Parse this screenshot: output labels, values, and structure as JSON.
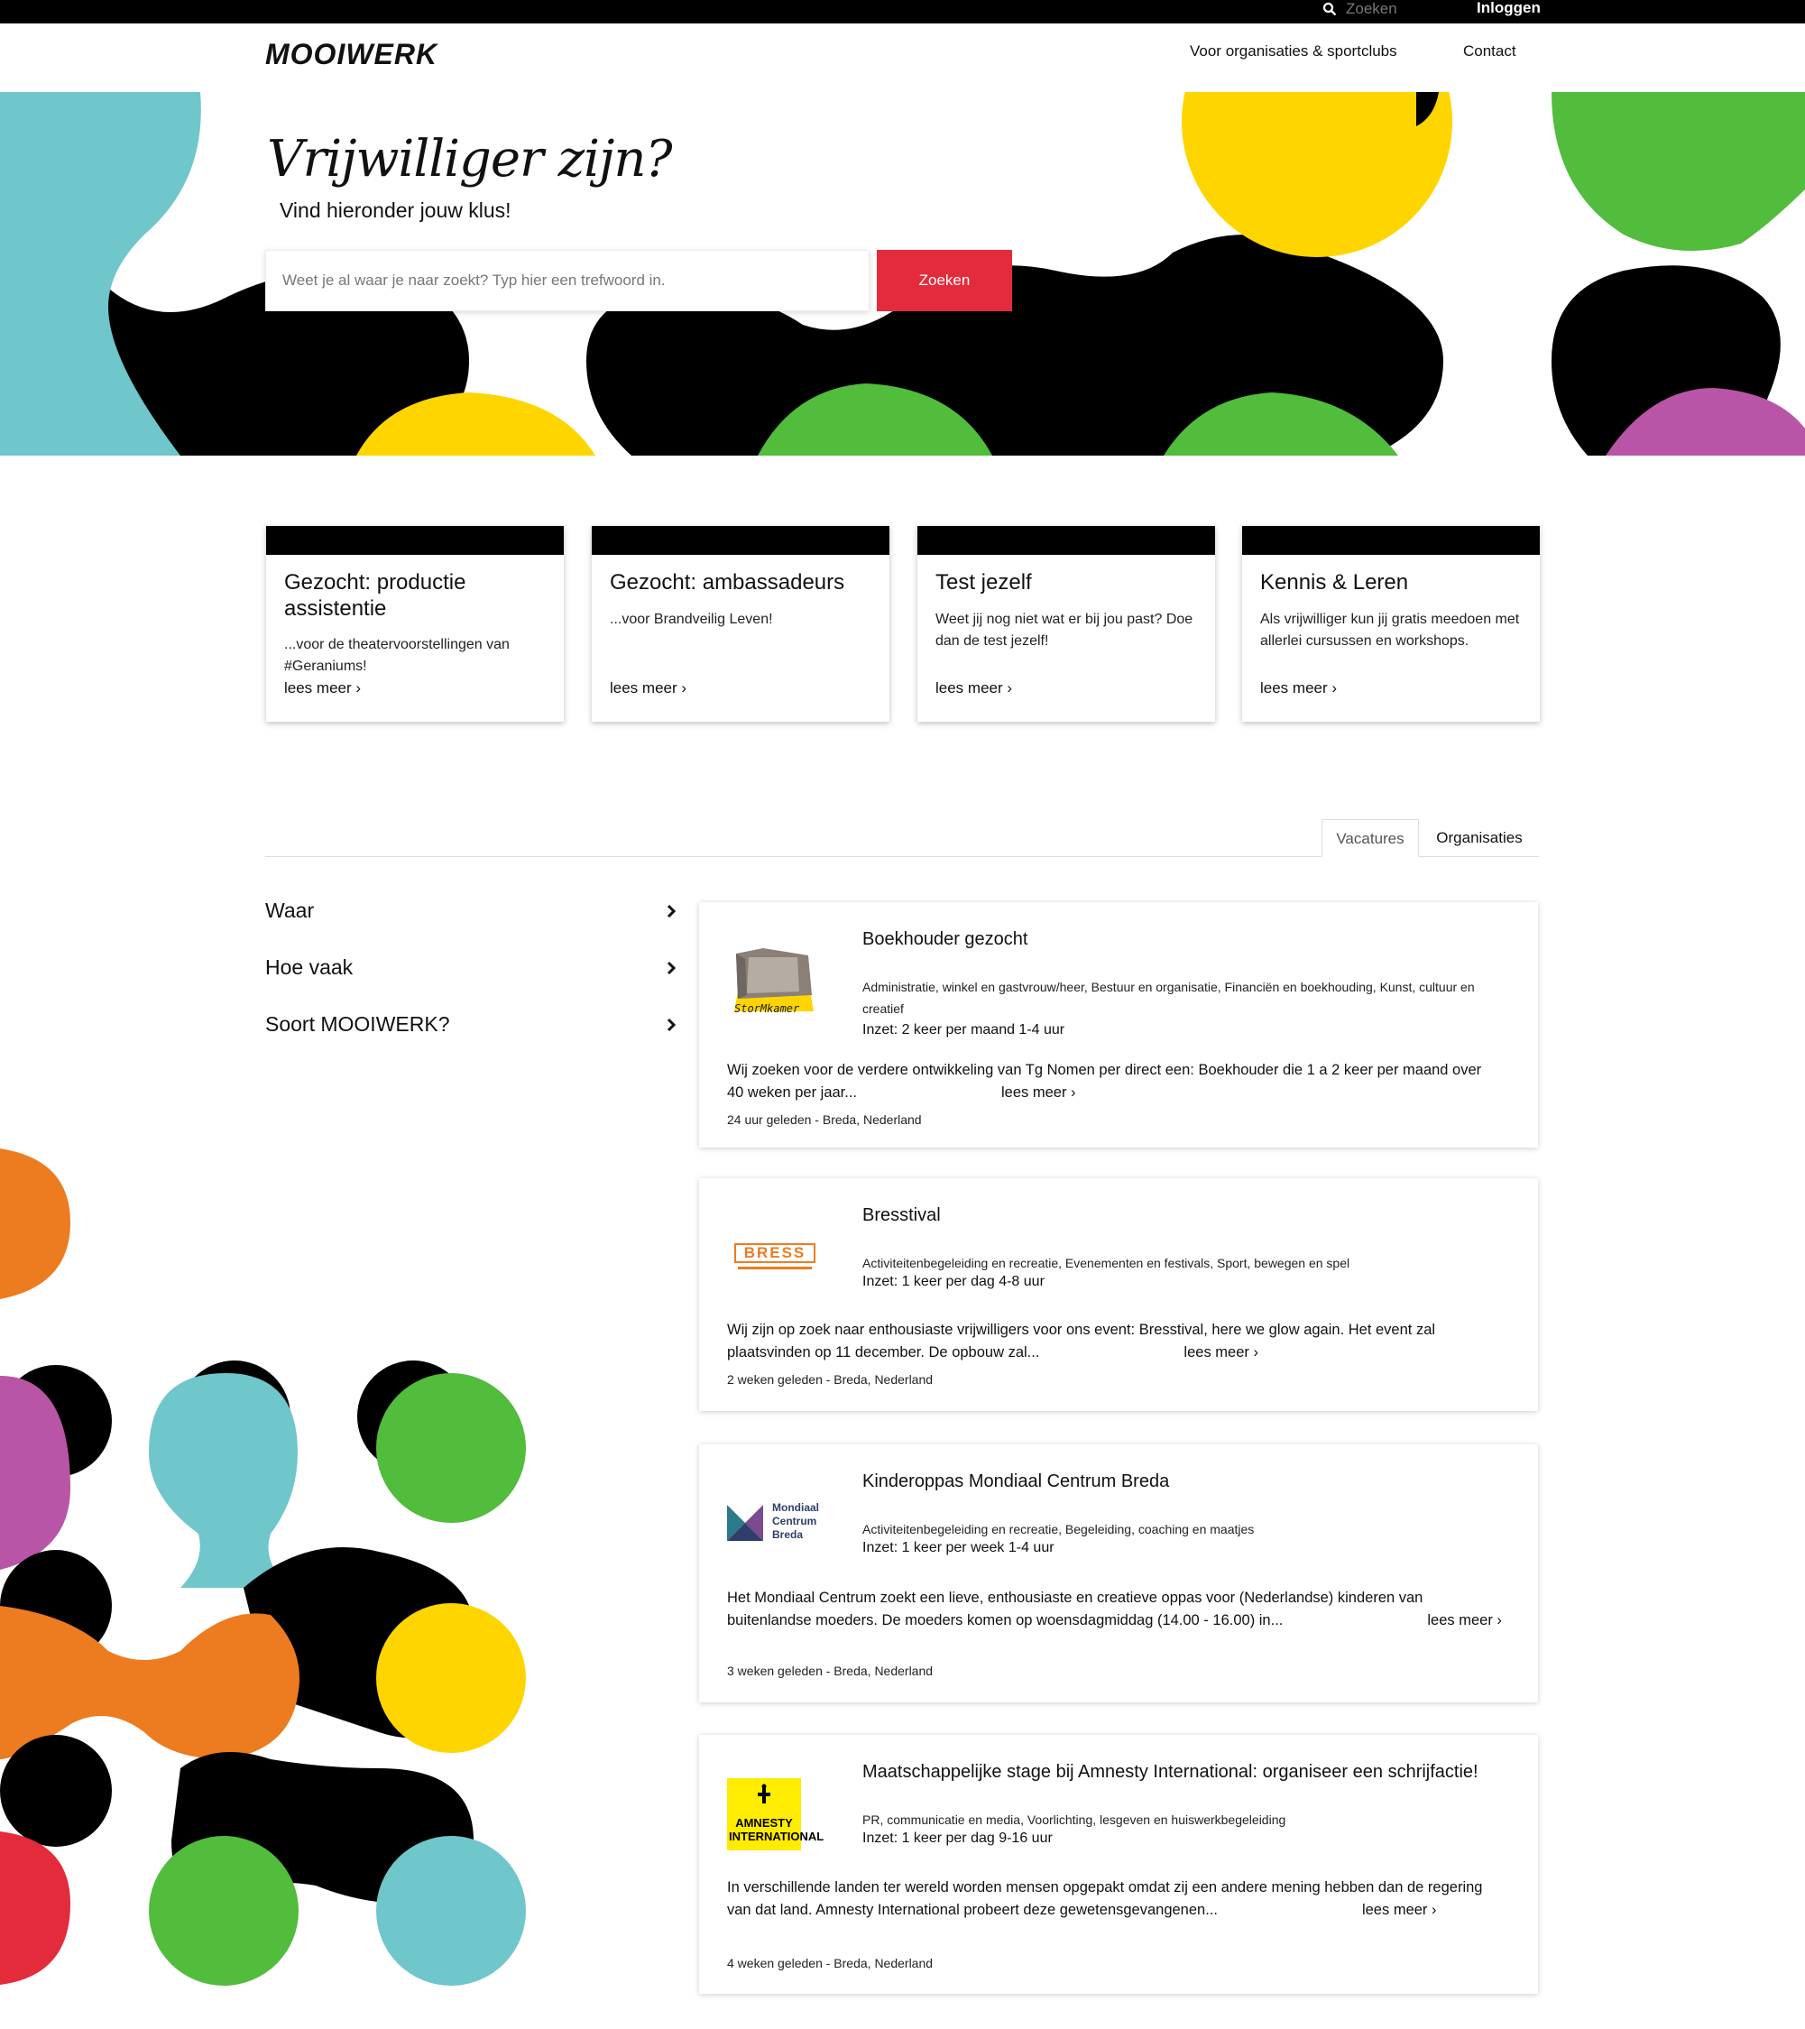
{
  "topbar": {
    "search_label": "Zoeken",
    "login_label": "Inloggen"
  },
  "header": {
    "logo_text": "MOOIWERK",
    "nav": [
      "Voor organisaties & sportclubs",
      "Contact"
    ]
  },
  "hero": {
    "title": "Vrijwilliger zijn?",
    "subtitle": "Vind hieronder jouw klus!",
    "search_placeholder": "Weet je al waar je naar zoekt? Typ hier een trefwoord in.",
    "search_button": "Zoeken"
  },
  "features": [
    {
      "title": "Gezocht: productie assistentie",
      "desc": "...voor de theatervoorstellingen van #Geraniums!",
      "more": "lees meer ›"
    },
    {
      "title": "Gezocht: ambassadeurs",
      "desc": "...voor Brandveilig Leven!",
      "more": "lees meer ›"
    },
    {
      "title": "Test jezelf",
      "desc": "Weet jij nog niet wat er bij jou past? Doe dan de test jezelf!",
      "more": "lees meer ›"
    },
    {
      "title": "Kennis & Leren",
      "desc": "Als vrijwilliger kun jij gratis meedoen met allerlei cursussen en workshops.",
      "more": "lees meer ›"
    }
  ],
  "tabs": [
    "Vacatures",
    "Organisaties"
  ],
  "filters": [
    "Waar",
    "Hoe vaak",
    "Soort MOOIWERK?"
  ],
  "vacancies": [
    {
      "title": "Boekhouder gezocht",
      "categories": "Administratie, winkel en gastvrouw/heer, Bestuur en organisatie, Financiën en boekhouding, Kunst, cultuur en creatief",
      "inzet": "Inzet: 2 keer per maand 1-4 uur",
      "desc": "Wij zoeken voor de verdere ontwikkeling van Tg Nomen per direct een: Boekhouder die  1 a 2 keer per maand over 40 weken per jaar...",
      "more": "lees meer ›",
      "meta": "24 uur geleden - Breda, Nederland",
      "logo_text": "StorMkamer"
    },
    {
      "title": "Bresstival",
      "categories": "Activiteitenbegeleiding en recreatie, Evenementen en festivals, Sport, bewegen en spel",
      "inzet": "Inzet: 1 keer per dag 4-8 uur",
      "desc": "Wij zijn op zoek naar enthousiaste vrijwilligers voor ons event: Bresstival, here we glow again. Het event zal plaatsvinden op 11 december. De opbouw zal...",
      "more": "lees meer ›",
      "meta": "2 weken geleden - Breda, Nederland",
      "logo_text": "BRESS"
    },
    {
      "title": "Kinderoppas Mondiaal Centrum Breda",
      "categories": "Activiteitenbegeleiding en recreatie, Begeleiding, coaching en maatjes",
      "inzet": "Inzet: 1 keer per week 1-4 uur",
      "desc": "Het Mondiaal Centrum zoekt een lieve, enthousiaste en creatieve oppas voor (Nederlandse) kinderen van buitenlandse moeders. De moeders komen op woensdagmiddag (14.00 - 16.00) in...",
      "more": "lees meer ›",
      "meta": "3 weken geleden - Breda, Nederland",
      "logo_text": "Mondiaal Centrum Breda"
    },
    {
      "title": "Maatschappelijke stage bij Amnesty International: organiseer een schrijfactie!",
      "categories": "PR, communicatie en media, Voorlichting, lesgeven en huiswerkbegeleiding",
      "inzet": "Inzet: 1 keer per dag 9-16 uur",
      "desc": "In verschillende landen ter wereld worden mensen opgepakt omdat zij een andere mening hebben dan de regering van dat land. Amnesty International probeert deze gewetensgevangenen...",
      "more": "lees meer ›",
      "meta": "4 weken geleden - Breda, Nederland",
      "logo_text": "AMNESTY INTERNATIONAL"
    }
  ],
  "colors": {
    "accent": "#e32b3b",
    "teal": "#6fc6cb",
    "yellow": "#ffd500",
    "green": "#52bc3c",
    "purple": "#b955a7",
    "orange": "#ed7b20",
    "black": "#000000"
  }
}
